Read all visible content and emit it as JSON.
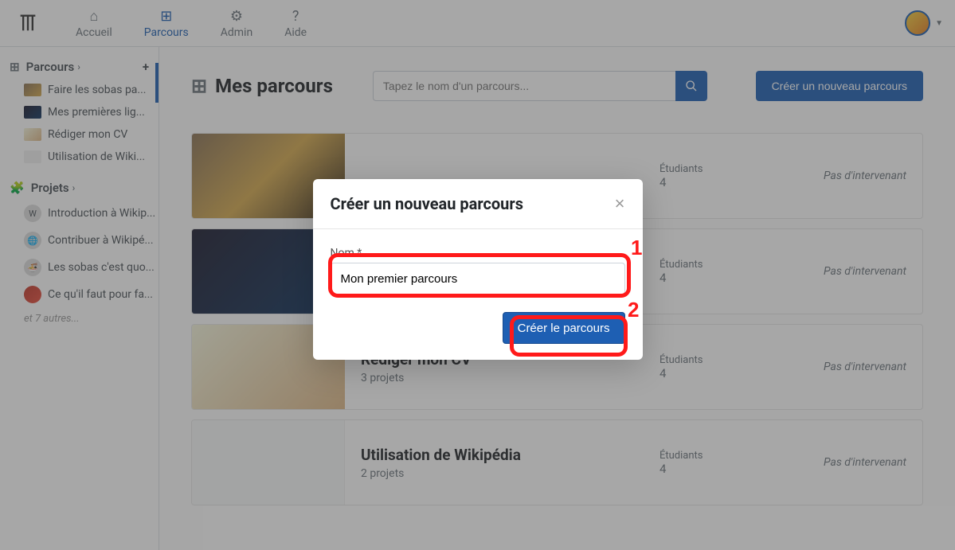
{
  "nav": {
    "accueil": "Accueil",
    "parcours": "Parcours",
    "admin": "Admin",
    "aide": "Aide"
  },
  "sidebar": {
    "parcours_label": "Parcours",
    "parcours_items": [
      "Faire les sobas pa...",
      "Mes premières lig...",
      "Rédiger mon CV",
      "Utilisation de Wiki..."
    ],
    "projets_label": "Projets",
    "projets_items": [
      "Introduction à Wikip...",
      "Contribuer à Wikipé...",
      "Les sobas c'est quo...",
      "Ce qu'il faut pour fa..."
    ],
    "more": "et 7 autres..."
  },
  "page": {
    "title": "Mes parcours",
    "search_placeholder": "Tapez le nom d'un parcours...",
    "new_btn": "Créer un nouveau parcours"
  },
  "labels": {
    "students": "Étudiants",
    "no_instructor": "Pas d'intervenant"
  },
  "cards": [
    {
      "title": "",
      "sub": "",
      "students": "4"
    },
    {
      "title": "",
      "sub": "",
      "students": "4"
    },
    {
      "title": "Rédiger mon CV",
      "sub": "3 projets",
      "students": "4"
    },
    {
      "title": "Utilisation de Wikipédia",
      "sub": "2 projets",
      "students": "4"
    }
  ],
  "modal": {
    "title": "Créer un nouveau parcours",
    "name_label": "Nom *",
    "name_value": "Mon premier parcours",
    "submit": "Créer le parcours"
  },
  "colors": {
    "primary": "#1e5fb3",
    "annotation": "#ff1a1a"
  }
}
